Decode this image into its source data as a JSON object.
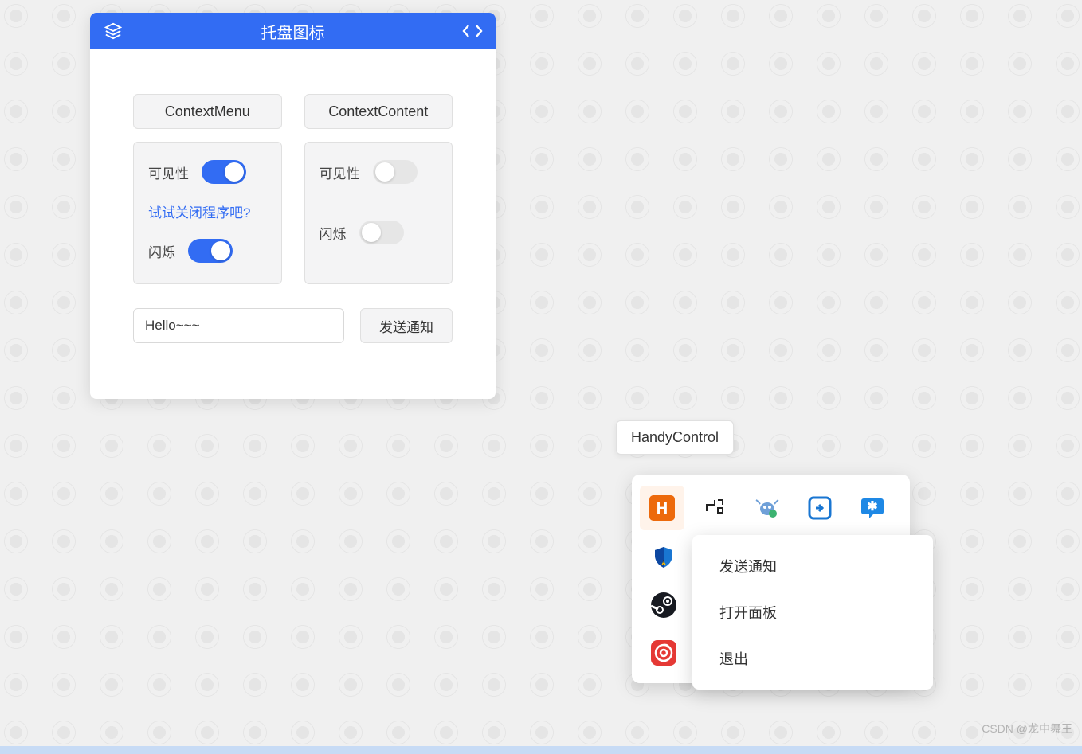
{
  "card": {
    "title": "托盘图标",
    "left_column": {
      "button_label": "ContextMenu",
      "visible_label": "可见性",
      "visible_on": true,
      "hint_link": "试试关闭程序吧?",
      "blink_label": "闪烁",
      "blink_on": true
    },
    "right_column": {
      "button_label": "ContextContent",
      "visible_label": "可见性",
      "visible_on": false,
      "blink_label": "闪烁",
      "blink_on": false
    },
    "input_value": "Hello~~~",
    "send_button": "发送通知"
  },
  "tooltip": {
    "label": "HandyControl"
  },
  "context_menu": {
    "items": [
      "发送通知",
      "打开面板",
      "退出"
    ]
  },
  "watermark": "CSDN @龙中舞王",
  "colors": {
    "primary": "#326cf3",
    "accent_orange": "#ed6a0c"
  }
}
